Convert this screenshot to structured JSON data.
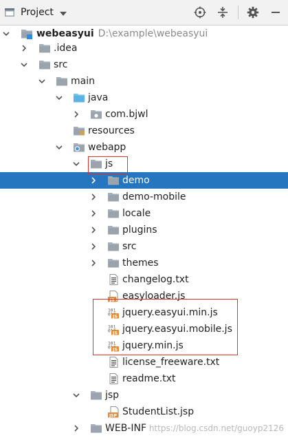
{
  "toolbar": {
    "title": "Project",
    "icons": [
      "project-view-icon",
      "dropdown-caret-icon",
      "locate-target-icon",
      "collapse-all-icon",
      "gear-icon",
      "hide-panel-icon"
    ]
  },
  "tree": {
    "root": {
      "name": "webeasyui",
      "path": "D:\\example\\webeasyui"
    },
    "items": {
      "idea": ".idea",
      "src": "src",
      "main": "main",
      "java": "java",
      "com_bjwl": "com.bjwl",
      "resources": "resources",
      "webapp": "webapp",
      "js": "js",
      "demo": "demo",
      "demo_mobile": "demo-mobile",
      "locale": "locale",
      "plugins": "plugins",
      "js_src": "src",
      "themes": "themes",
      "changelog": "changelog.txt",
      "easyloader": "easyloader.js",
      "jq_easyui_min": "jquery.easyui.min.js",
      "jq_easyui_mobile": "jquery.easyui.mobile.js",
      "jq_min": "jquery.min.js",
      "license": "license_freeware.txt",
      "readme": "readme.txt",
      "jsp": "jsp",
      "studentlist": "StudentList.jsp",
      "webinf": "WEB-INF"
    },
    "selected": "demo"
  },
  "colors": {
    "selection": "#2675bf",
    "annotation": "#e0302a",
    "folder": "#9fa8b3",
    "source_folder": "#5fb3e6"
  },
  "watermark": "https://blog.csdn.net/guoyp2126"
}
